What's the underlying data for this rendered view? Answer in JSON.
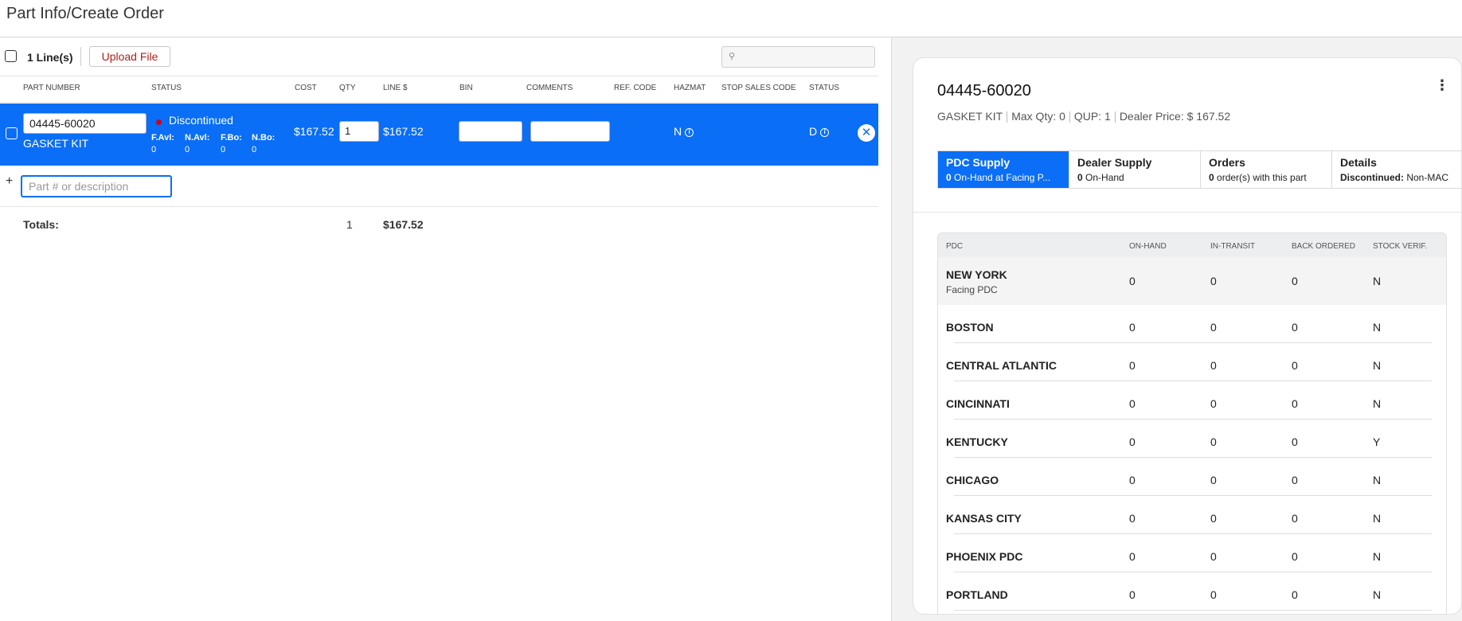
{
  "header": {
    "title": "Part Info/Create Order"
  },
  "toolbar": {
    "lines_label": "1 Line(s)",
    "upload_label": "Upload File",
    "search_placeholder": ""
  },
  "columns": {
    "part_number": "PART NUMBER",
    "status": "STATUS",
    "cost": "COST",
    "qty": "QTY",
    "line": "LINE $",
    "bin": "BIN",
    "comments": "COMMENTS",
    "ref_code": "REF. CODE",
    "hazmat": "HAZMAT",
    "stop_sales": "STOP SALES CODE",
    "status2": "STATUS"
  },
  "line_item": {
    "part_number": "04445-60020",
    "description": "GASKET KIT",
    "status": "Discontinued",
    "avail": [
      {
        "label": "F.Avl:",
        "value": "0"
      },
      {
        "label": "N.Avl:",
        "value": "0"
      },
      {
        "label": "F.Bo:",
        "value": "0"
      },
      {
        "label": "N.Bo:",
        "value": "0"
      }
    ],
    "cost": "$167.52",
    "qty": "1",
    "line_total": "$167.52",
    "hazmat": "N",
    "status_code": "D"
  },
  "add_row": {
    "plus": "+",
    "placeholder": "Part # or description"
  },
  "totals": {
    "label": "Totals:",
    "qty": "1",
    "amount": "$167.52"
  },
  "detail": {
    "part_number": "04445-60020",
    "description": "GASKET KIT",
    "max_qty": "Max Qty: 0",
    "qup": "QUP: 1",
    "dealer_price": "Dealer Price: $ 167.52",
    "tabs": [
      {
        "title": "PDC Supply",
        "count": "0",
        "sub": " On-Hand at Facing P..."
      },
      {
        "title": "Dealer Supply",
        "count": "0",
        "sub": " On-Hand"
      },
      {
        "title": "Orders",
        "count": "0",
        "sub": " order(s) with this part"
      },
      {
        "title": "Details",
        "count": "Discontinued:",
        "sub": " Non-MAC"
      }
    ],
    "table_headers": {
      "pdc": "PDC",
      "on_hand": "ON-HAND",
      "in_transit": "IN-TRANSIT",
      "back_ordered": "BACK ORDERED",
      "stock_verif": "STOCK VERIF."
    },
    "rows": [
      {
        "name": "NEW YORK",
        "sub": "Facing PDC",
        "on_hand": "0",
        "in_transit": "0",
        "back_ordered": "0",
        "verif": "N"
      },
      {
        "name": "BOSTON",
        "on_hand": "0",
        "in_transit": "0",
        "back_ordered": "0",
        "verif": "N"
      },
      {
        "name": "CENTRAL ATLANTIC",
        "on_hand": "0",
        "in_transit": "0",
        "back_ordered": "0",
        "verif": "N"
      },
      {
        "name": "CINCINNATI",
        "on_hand": "0",
        "in_transit": "0",
        "back_ordered": "0",
        "verif": "N"
      },
      {
        "name": "KENTUCKY",
        "on_hand": "0",
        "in_transit": "0",
        "back_ordered": "0",
        "verif": "Y"
      },
      {
        "name": "CHICAGO",
        "on_hand": "0",
        "in_transit": "0",
        "back_ordered": "0",
        "verif": "N"
      },
      {
        "name": "KANSAS CITY",
        "on_hand": "0",
        "in_transit": "0",
        "back_ordered": "0",
        "verif": "N"
      },
      {
        "name": "PHOENIX PDC",
        "on_hand": "0",
        "in_transit": "0",
        "back_ordered": "0",
        "verif": "N"
      },
      {
        "name": "PORTLAND",
        "on_hand": "0",
        "in_transit": "0",
        "back_ordered": "0",
        "verif": "N"
      }
    ]
  }
}
